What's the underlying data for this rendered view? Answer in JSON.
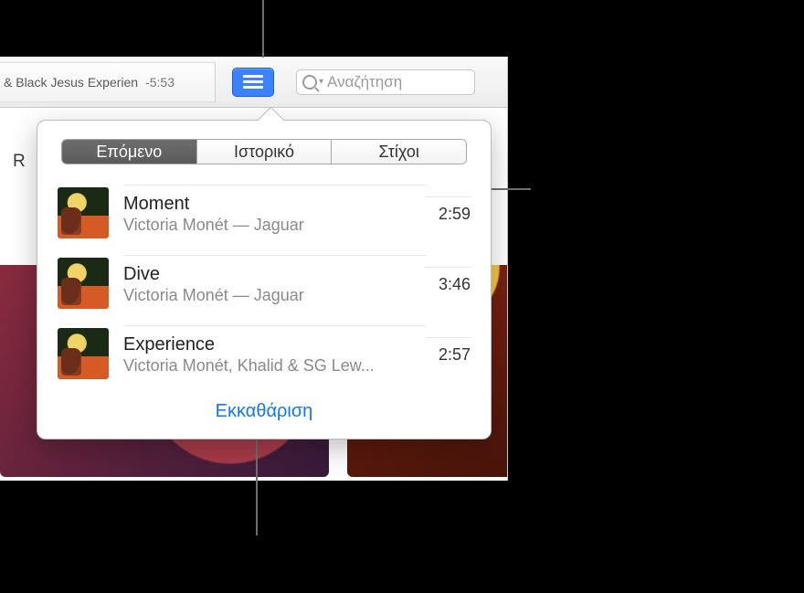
{
  "now_playing": {
    "title_fragment": "& Black Jesus Experien",
    "remaining": "-5:53"
  },
  "search": {
    "placeholder": "Αναζήτηση"
  },
  "subbar": {
    "tab_fragment": "R"
  },
  "popover": {
    "tabs": {
      "up_next": "Επόμενο",
      "history": "Ιστορικό",
      "lyrics": "Στίχοι"
    },
    "queue": [
      {
        "title": "Moment",
        "artist": "Victoria Monét — Jaguar",
        "duration": "2:59"
      },
      {
        "title": "Dive",
        "artist": "Victoria Monét — Jaguar",
        "duration": "3:46"
      },
      {
        "title": "Experience",
        "artist": "Victoria Monét, Khalid & SG Lew...",
        "duration": "2:57"
      }
    ],
    "clear_label": "Εκκαθάριση"
  }
}
